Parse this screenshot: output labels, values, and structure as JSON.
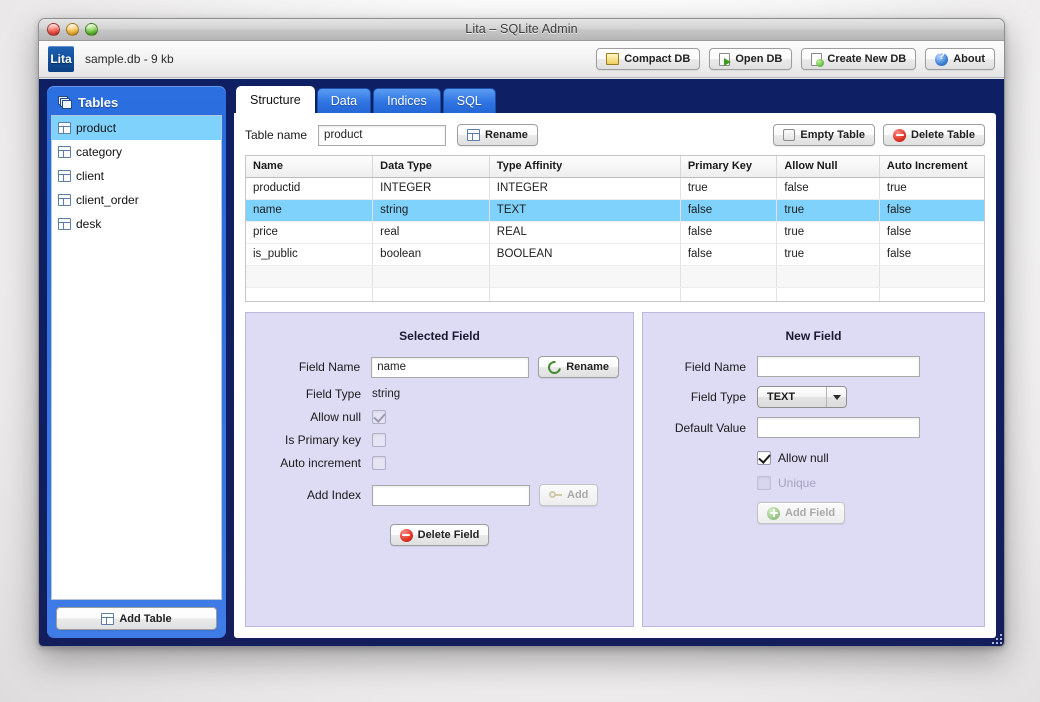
{
  "window": {
    "title": "Lita – SQLite Admin",
    "traffic_lights": [
      "close-button",
      "minimize-button",
      "zoom-button"
    ]
  },
  "toolbar": {
    "logo_text": "Lita",
    "db_info": "sample.db - 9 kb",
    "buttons": [
      {
        "label": "Compact DB",
        "icon": "compact-db-icon"
      },
      {
        "label": "Open DB",
        "icon": "open-db-icon"
      },
      {
        "label": "Create New DB",
        "icon": "create-db-icon"
      },
      {
        "label": "About",
        "icon": "about-icon"
      }
    ]
  },
  "sidebar": {
    "header": "Tables",
    "header_icon": "tables-icon",
    "items": [
      {
        "label": "product",
        "selected": true
      },
      {
        "label": "category",
        "selected": false
      },
      {
        "label": "client",
        "selected": false
      },
      {
        "label": "client_order",
        "selected": false
      },
      {
        "label": "desk",
        "selected": false
      }
    ],
    "add_table_label": "Add Table"
  },
  "tabs": [
    {
      "label": "Structure",
      "active": true
    },
    {
      "label": "Data",
      "active": false
    },
    {
      "label": "Indices",
      "active": false
    },
    {
      "label": "SQL",
      "active": false
    }
  ],
  "structure": {
    "table_name_label": "Table name",
    "table_name_value": "product",
    "table_name_placeholder": "",
    "rename_label": "Rename",
    "empty_table_label": "Empty Table",
    "delete_table_label": "Delete Table",
    "columns": [
      "Name",
      "Data Type",
      "Type Affinity",
      "Primary Key",
      "Allow Null",
      "Auto Increment"
    ],
    "rows": [
      {
        "cells": [
          "productid",
          "INTEGER",
          "INTEGER",
          "true",
          "false",
          "true"
        ],
        "selected": false
      },
      {
        "cells": [
          "name",
          "string",
          "TEXT",
          "false",
          "true",
          "false"
        ],
        "selected": true
      },
      {
        "cells": [
          "price",
          "real",
          "REAL",
          "false",
          "true",
          "false"
        ],
        "selected": false
      },
      {
        "cells": [
          "is_public",
          "boolean",
          "BOOLEAN",
          "false",
          "true",
          "false"
        ],
        "selected": false
      }
    ]
  },
  "selected_field": {
    "title": "Selected Field",
    "field_name_label": "Field Name",
    "field_name_value": "name",
    "rename_label": "Rename",
    "field_type_label": "Field Type",
    "field_type_value": "string",
    "allow_null_label": "Allow null",
    "allow_null_checked": true,
    "is_primary_key_label": "Is Primary key",
    "is_primary_key_checked": false,
    "auto_increment_label": "Auto increment",
    "auto_increment_checked": false,
    "add_index_label": "Add Index",
    "add_index_value": "",
    "add_label": "Add",
    "delete_field_label": "Delete Field"
  },
  "new_field": {
    "title": "New Field",
    "field_name_label": "Field Name",
    "field_name_value": "",
    "field_type_label": "Field Type",
    "field_type_value": "TEXT",
    "default_value_label": "Default Value",
    "default_value_value": "",
    "allow_null_label": "Allow  null",
    "allow_null_checked": true,
    "unique_label": "Unique",
    "unique_checked": false,
    "add_field_label": "Add Field"
  },
  "colors": {
    "window_chrome": "#c6c6c6",
    "app_background_blue": "#141e5c",
    "sidebar_blue": "#2f74e2",
    "selection_blue": "#7fd2fc",
    "pane_lavender": "#dedbf5",
    "logo_blue": "#13519e"
  }
}
